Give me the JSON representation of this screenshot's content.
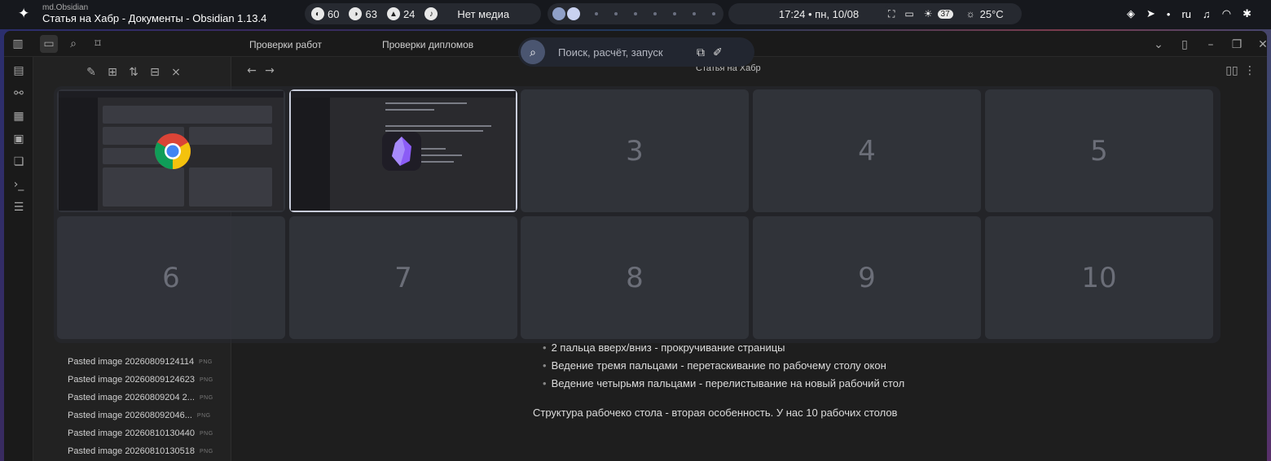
{
  "topbar": {
    "app_id": "md.Obsidian",
    "window_title": "Статья на Хабр - Документы - Obsidian 1.13.4",
    "stats": [
      {
        "icon": "cpu-icon",
        "value": "60"
      },
      {
        "icon": "memory-icon",
        "value": "63"
      },
      {
        "icon": "disk-icon",
        "value": "24"
      }
    ],
    "media_text": "Нет медиа",
    "clock": "17:24 • пн, 10/08",
    "battery_badge": "37",
    "weather": "25°C",
    "keyboard_layout": "ru"
  },
  "launcher": {
    "placeholder": "Поиск, расчёт, запуск"
  },
  "window": {
    "tabs": [
      "Проверки работ",
      "Проверки дипломов"
    ],
    "breadcrumb": "Статья на Хабр"
  },
  "sidebar": {
    "files": [
      {
        "name": "Pasted image 20260809124114",
        "ext": "PNG"
      },
      {
        "name": "Pasted image 20260809124623",
        "ext": "PNG"
      },
      {
        "name": "Pasted image 20260809204 2...",
        "ext": "PNG"
      },
      {
        "name": "Pasted image 202608092046...",
        "ext": "PNG"
      },
      {
        "name": "Pasted image 20260810130440",
        "ext": "PNG"
      },
      {
        "name": "Pasted image 20260810130518",
        "ext": "PNG"
      }
    ]
  },
  "content": {
    "bullets": [
      "2 пальца вверх/вниз - прокручивание страницы",
      "Ведение тремя пальцами  - перетаскивание по рабочему столу окон",
      "Ведение четырьмя пальцами - перелистывание на новый рабочий стол"
    ],
    "paragraph": "Структура рабочеко стола - вторая особенность. У нас 10 рабочих столов"
  },
  "overview": {
    "workspaces": [
      "1",
      "2",
      "3",
      "4",
      "5",
      "6",
      "7",
      "8",
      "9",
      "10"
    ],
    "active_workspace": "2"
  }
}
